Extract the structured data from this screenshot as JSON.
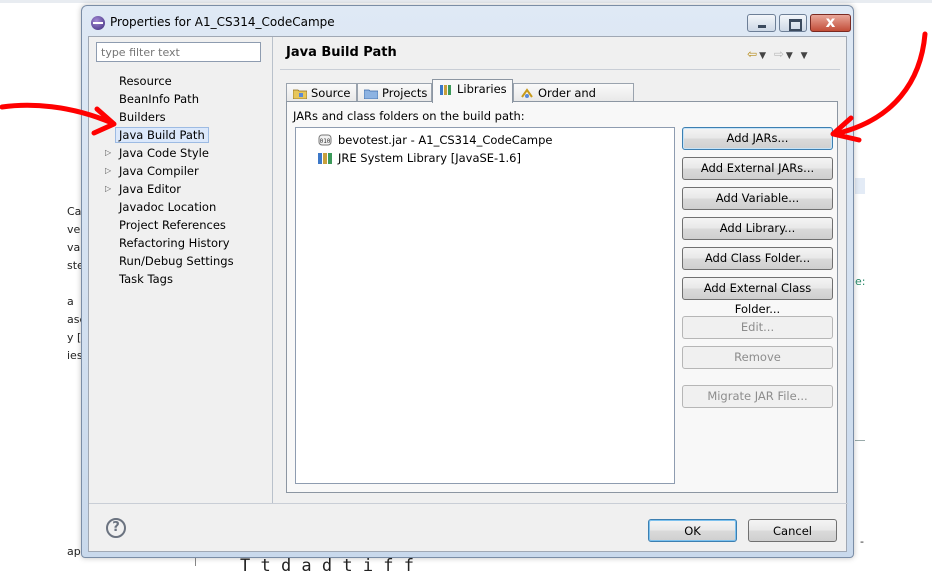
{
  "background": {
    "left_fragments": [
      "Ca",
      "ve",
      "va",
      "ste",
      "a",
      "ase",
      "y [",
      "ies",
      "ap"
    ],
    "right_fragments": [
      "e:",
      "ᵉ",
      "-"
    ],
    "bottom_text": "T    t       d   a   d       t  i   f   f"
  },
  "window": {
    "title": "Properties for A1_CS314_CodeCampe",
    "close_label": "x"
  },
  "filter": {
    "placeholder": "type filter text"
  },
  "tree": {
    "items": [
      {
        "label": "Resource",
        "expandable": false
      },
      {
        "label": "BeanInfo Path",
        "expandable": false
      },
      {
        "label": "Builders",
        "expandable": false
      },
      {
        "label": "Java Build Path",
        "expandable": false,
        "selected": true
      },
      {
        "label": "Java Code Style",
        "expandable": true
      },
      {
        "label": "Java Compiler",
        "expandable": true
      },
      {
        "label": "Java Editor",
        "expandable": true
      },
      {
        "label": "Javadoc Location",
        "expandable": false
      },
      {
        "label": "Project References",
        "expandable": false
      },
      {
        "label": "Refactoring History",
        "expandable": false
      },
      {
        "label": "Run/Debug Settings",
        "expandable": false
      },
      {
        "label": "Task Tags",
        "expandable": false
      }
    ]
  },
  "page": {
    "title": "Java Build Path"
  },
  "tabs": [
    {
      "label": "Source",
      "icon": "source-folder-icon"
    },
    {
      "label": "Projects",
      "icon": "projects-icon"
    },
    {
      "label": "Libraries",
      "icon": "libraries-icon",
      "active": true
    },
    {
      "label": "Order and Export",
      "icon": "order-export-icon"
    }
  ],
  "libraries": {
    "caption": "JARs and class folders on the build path:",
    "entries": [
      {
        "label": "bevotest.jar - A1_CS314_CodeCampe",
        "icon": "jar-icon"
      },
      {
        "label": "JRE System Library [JavaSE-1.6]",
        "icon": "library-icon"
      }
    ]
  },
  "buttons": {
    "add_jars": "Add JARs...",
    "add_external_jars": "Add External JARs...",
    "add_variable": "Add Variable...",
    "add_library": "Add Library...",
    "add_class_folder": "Add Class Folder...",
    "add_external_class_folder": "Add External Class Folder...",
    "edit": "Edit...",
    "remove": "Remove",
    "migrate_jar": "Migrate JAR File..."
  },
  "dialog": {
    "help": "?",
    "ok": "OK",
    "cancel": "Cancel"
  },
  "colors": {
    "annotation_arrow": "#ff0000",
    "selection": "#dbe8fb"
  }
}
